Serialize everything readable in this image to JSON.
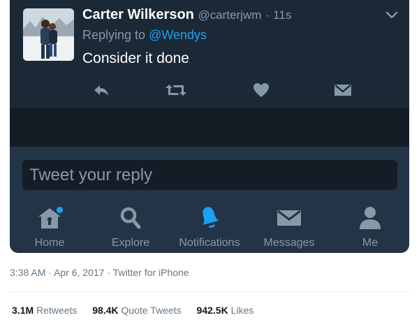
{
  "tweet": {
    "author_name": "Carter Wilkerson",
    "author_handle": "@carterjwm",
    "separator": "·",
    "age": "11s",
    "replying_prefix": "Replying to",
    "replying_mention": "@Wendys",
    "text": "Consider it done"
  },
  "actions": [
    {
      "name": "reply-icon",
      "label": "reply"
    },
    {
      "name": "retweet-icon",
      "label": "retweet"
    },
    {
      "name": "like-icon",
      "label": "like"
    },
    {
      "name": "direct-message-icon",
      "label": "message"
    }
  ],
  "reply_box": {
    "placeholder": "Tweet your reply"
  },
  "tabbar": {
    "items": [
      {
        "label": "Home",
        "icon": "home-icon",
        "active": false,
        "has_dot": true
      },
      {
        "label": "Explore",
        "icon": "search-icon",
        "active": false
      },
      {
        "label": "Notifications",
        "icon": "bell-icon",
        "active": true
      },
      {
        "label": "Messages",
        "icon": "envelope-icon",
        "active": false
      },
      {
        "label": "Me",
        "icon": "person-icon",
        "active": false
      }
    ]
  },
  "meta": {
    "time": "3:38 AM",
    "date": "Apr 6, 2017",
    "source": "Twitter for iPhone",
    "separator": "·"
  },
  "stats": {
    "retweets_count": "3.1M",
    "retweets_label": "Retweets",
    "quotes_count": "98.4K",
    "quotes_label": "Quote Tweets",
    "likes_count": "942.5K",
    "likes_label": "Likes"
  },
  "colors": {
    "background_dark": "#243447",
    "tweet_bg": "#1b2836",
    "accent_blue": "#1da1f2",
    "muted_gray": "#8899a6"
  }
}
